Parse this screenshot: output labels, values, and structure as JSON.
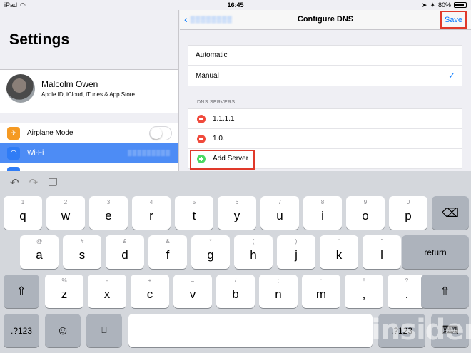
{
  "status_bar": {
    "device": "iPad",
    "time": "16:45",
    "battery": "80%"
  },
  "left": {
    "title": "Settings",
    "profile": {
      "name": "Malcolm Owen",
      "subtitle": "Apple ID, iCloud, iTunes & App Store"
    },
    "items": [
      {
        "label": "Airplane Mode",
        "icon": "airplane-icon",
        "color": "#f59a23"
      },
      {
        "label": "Wi-Fi",
        "icon": "wifi-icon",
        "color": "#2f7cf6",
        "selected": true
      }
    ]
  },
  "nav": {
    "title": "Configure DNS",
    "save": "Save"
  },
  "config": {
    "options": [
      {
        "label": "Automatic",
        "checked": false
      },
      {
        "label": "Manual",
        "checked": true
      }
    ]
  },
  "dns": {
    "header": "DNS SERVERS",
    "servers": [
      "1.1.1.1",
      "1.0."
    ],
    "add_label": "Add Server"
  },
  "keyboard": {
    "row1": [
      [
        "1",
        "q"
      ],
      [
        "2",
        "w"
      ],
      [
        "3",
        "e"
      ],
      [
        "4",
        "r"
      ],
      [
        "5",
        "t"
      ],
      [
        "6",
        "y"
      ],
      [
        "7",
        "u"
      ],
      [
        "8",
        "i"
      ],
      [
        "9",
        "o"
      ],
      [
        "0",
        "p"
      ]
    ],
    "row2": [
      [
        "@",
        "a"
      ],
      [
        "#",
        "s"
      ],
      [
        "£",
        "d"
      ],
      [
        "&",
        "f"
      ],
      [
        "*",
        "g"
      ],
      [
        "(",
        "h"
      ],
      [
        ")",
        "j"
      ],
      [
        "'",
        "k"
      ],
      [
        "\"",
        "l"
      ]
    ],
    "row3": [
      [
        "%",
        "z"
      ],
      [
        "-",
        "x"
      ],
      [
        "+",
        "c"
      ],
      [
        "=",
        "v"
      ],
      [
        "/",
        "b"
      ],
      [
        ";",
        "n"
      ],
      [
        ":",
        "m"
      ],
      [
        "!",
        ","
      ],
      [
        "?",
        "."
      ]
    ],
    "return": "return",
    "numbers": ".?123"
  },
  "watermark": "appleinsider"
}
